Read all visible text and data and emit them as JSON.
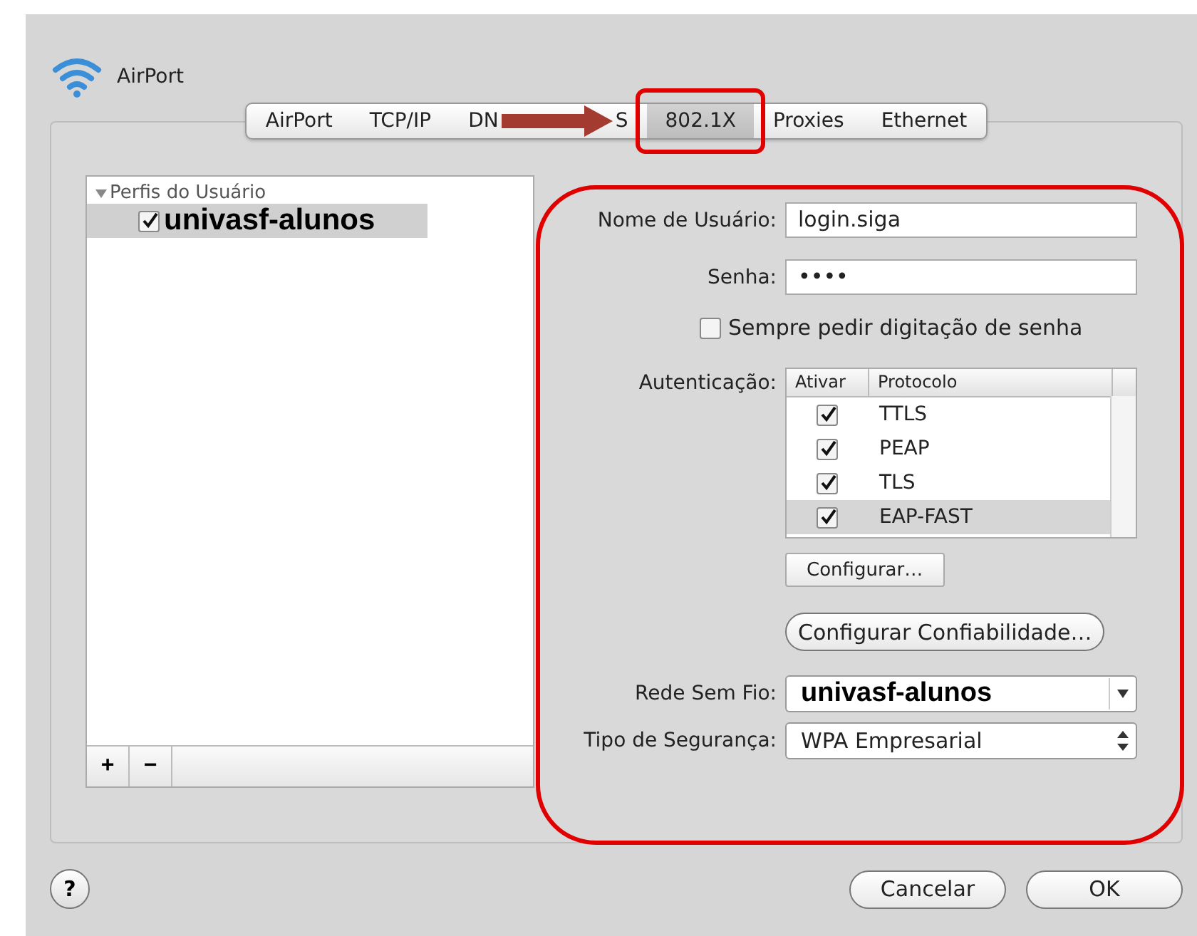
{
  "window": {
    "title": "AirPort"
  },
  "tabs": [
    {
      "label": "AirPort",
      "selected": false
    },
    {
      "label": "TCP/IP",
      "selected": false
    },
    {
      "label": "DN",
      "selected": false
    },
    {
      "label": "S",
      "selected": false
    },
    {
      "label": "802.1X",
      "selected": true
    },
    {
      "label": "Proxies",
      "selected": false
    },
    {
      "label": "Ethernet",
      "selected": false
    }
  ],
  "profiles": {
    "group": "Perfis do Usuário",
    "expanded": true,
    "items": [
      {
        "label": "univasf-alunos",
        "checked": true,
        "selected": true
      }
    ]
  },
  "list_buttons": [
    "+",
    "−"
  ],
  "form": {
    "username_label": "Nome de Usuário:",
    "username": "login.siga",
    "password_label": "Senha:",
    "password": "••••",
    "always_ask": {
      "label": "Sempre pedir digitação de senha",
      "checked": false
    },
    "auth_label": "Autenticação:",
    "auth_table": {
      "columns": [
        "Ativar",
        "Protocolo"
      ],
      "rows": [
        {
          "protocol": "TTLS",
          "checked": true,
          "selected": false
        },
        {
          "protocol": "PEAP",
          "checked": true,
          "selected": false
        },
        {
          "protocol": "TLS",
          "checked": true,
          "selected": false
        },
        {
          "protocol": "EAP-FAST",
          "checked": true,
          "selected": true
        }
      ]
    },
    "configure_button": "Configurar…",
    "trust_button": "Configurar Confiabilidade…",
    "network_label": "Rede Sem Fio:",
    "network": "univasf-alunos",
    "security_label": "Tipo de Segurança:",
    "security": "WPA Empresarial"
  },
  "help": "?",
  "buttons": [
    "Cancelar",
    "OK"
  ]
}
